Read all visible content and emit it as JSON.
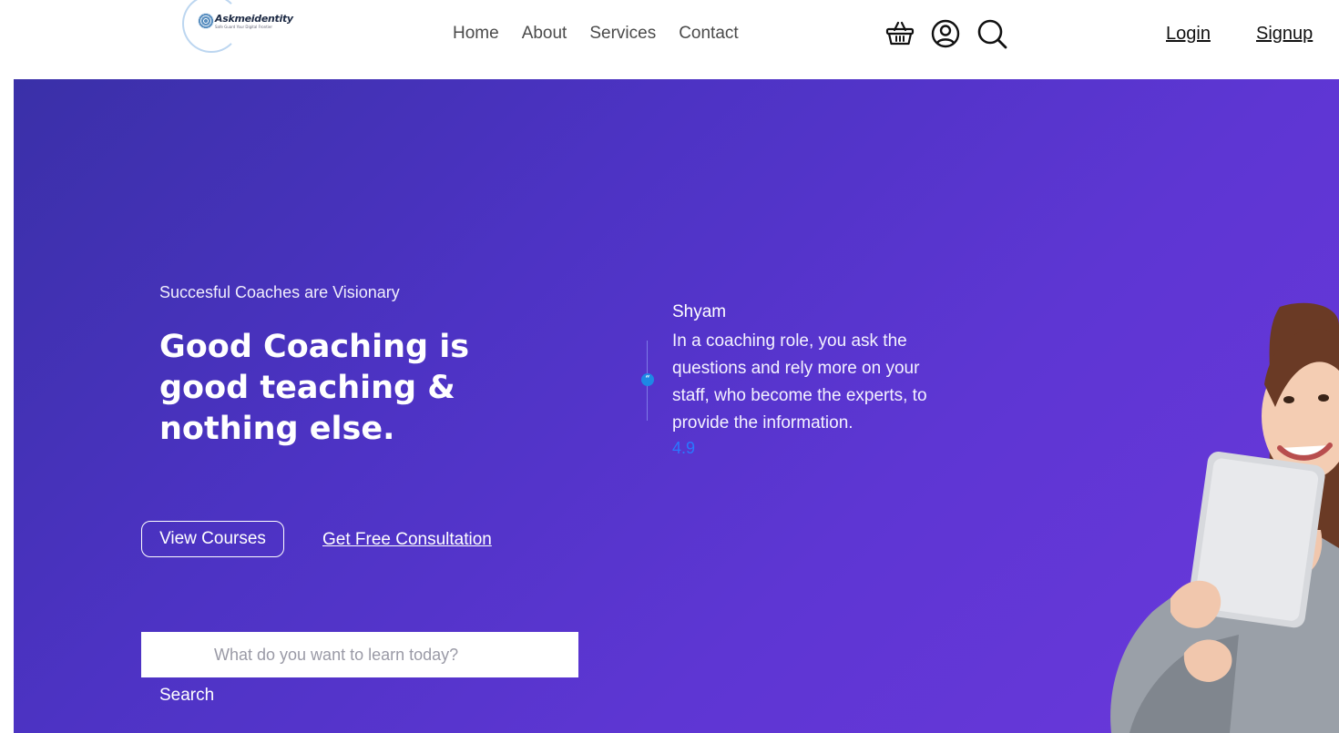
{
  "brand": {
    "name": "Askmeidentity",
    "tagline": "Safe Guard Your Digital Frontier"
  },
  "nav": {
    "links": [
      "Home",
      "About",
      "Services",
      "Contact"
    ]
  },
  "header_icons": [
    "basket-icon",
    "user-icon",
    "search-icon"
  ],
  "auth": {
    "login": "Login",
    "signup": "Signup"
  },
  "hero": {
    "eyebrow": "Succesful Coaches are Visionary",
    "headline": "Good Coaching is good teaching & nothing else.",
    "primary_button": "View Courses",
    "secondary_button": "Get Free Consultation",
    "search": {
      "placeholder": "What do you want to learn today?",
      "value": "",
      "button": "Search"
    }
  },
  "testimonial": {
    "name": "Shyam",
    "quote": "In a coaching role, you ask the questions and rely more on your staff, who become the experts, to provide the information.",
    "rating": "4.9"
  },
  "colors": {
    "hero_gradient_start": "#3a30a8",
    "hero_gradient_end": "#6a38db",
    "accent_blue": "#1e88e5",
    "rating_blue": "#2979ff"
  }
}
